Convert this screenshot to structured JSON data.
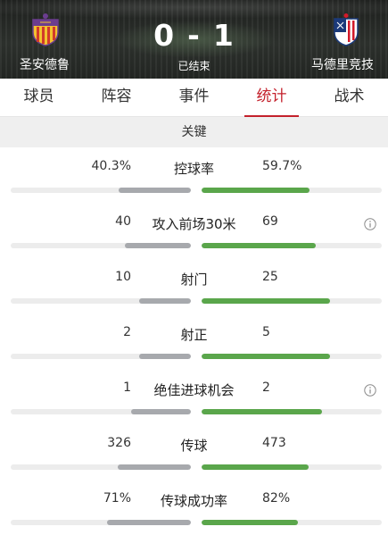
{
  "header": {
    "home_team": "圣安德鲁",
    "away_team": "马德里竞技",
    "home_score": "0",
    "separator": "-",
    "away_score": "1",
    "status": "已结束",
    "home_logo": "home-team-crest-icon",
    "away_logo": "away-team-crest-icon"
  },
  "tabs": [
    {
      "label": "球员"
    },
    {
      "label": "阵容"
    },
    {
      "label": "事件"
    },
    {
      "label": "统计",
      "active": true
    },
    {
      "label": "战术"
    }
  ],
  "section": {
    "title": "关键"
  },
  "colors": {
    "accent": "#c4212c",
    "home_bar": "#a7a9ad",
    "away_bar": "#5aa64b",
    "track": "#ececec"
  },
  "stats": [
    {
      "label": "控球率",
      "home": "40.3%",
      "away": "59.7%",
      "home_fill": 0.403,
      "away_fill": 0.597,
      "info": false
    },
    {
      "label": "攻入前场30米",
      "home": "40",
      "away": "69",
      "home_fill": 0.367,
      "away_fill": 0.633,
      "info": true
    },
    {
      "label": "射门",
      "home": "10",
      "away": "25",
      "home_fill": 0.286,
      "away_fill": 0.714,
      "info": false
    },
    {
      "label": "射正",
      "home": "2",
      "away": "5",
      "home_fill": 0.286,
      "away_fill": 0.714,
      "info": false
    },
    {
      "label": "绝佳进球机会",
      "home": "1",
      "away": "2",
      "home_fill": 0.333,
      "away_fill": 0.667,
      "info": true
    },
    {
      "label": "传球",
      "home": "326",
      "away": "473",
      "home_fill": 0.408,
      "away_fill": 0.592,
      "info": false
    },
    {
      "label": "传球成功率",
      "home": "71%",
      "away": "82%",
      "home_fill": 0.464,
      "away_fill": 0.536,
      "info": false
    }
  ]
}
